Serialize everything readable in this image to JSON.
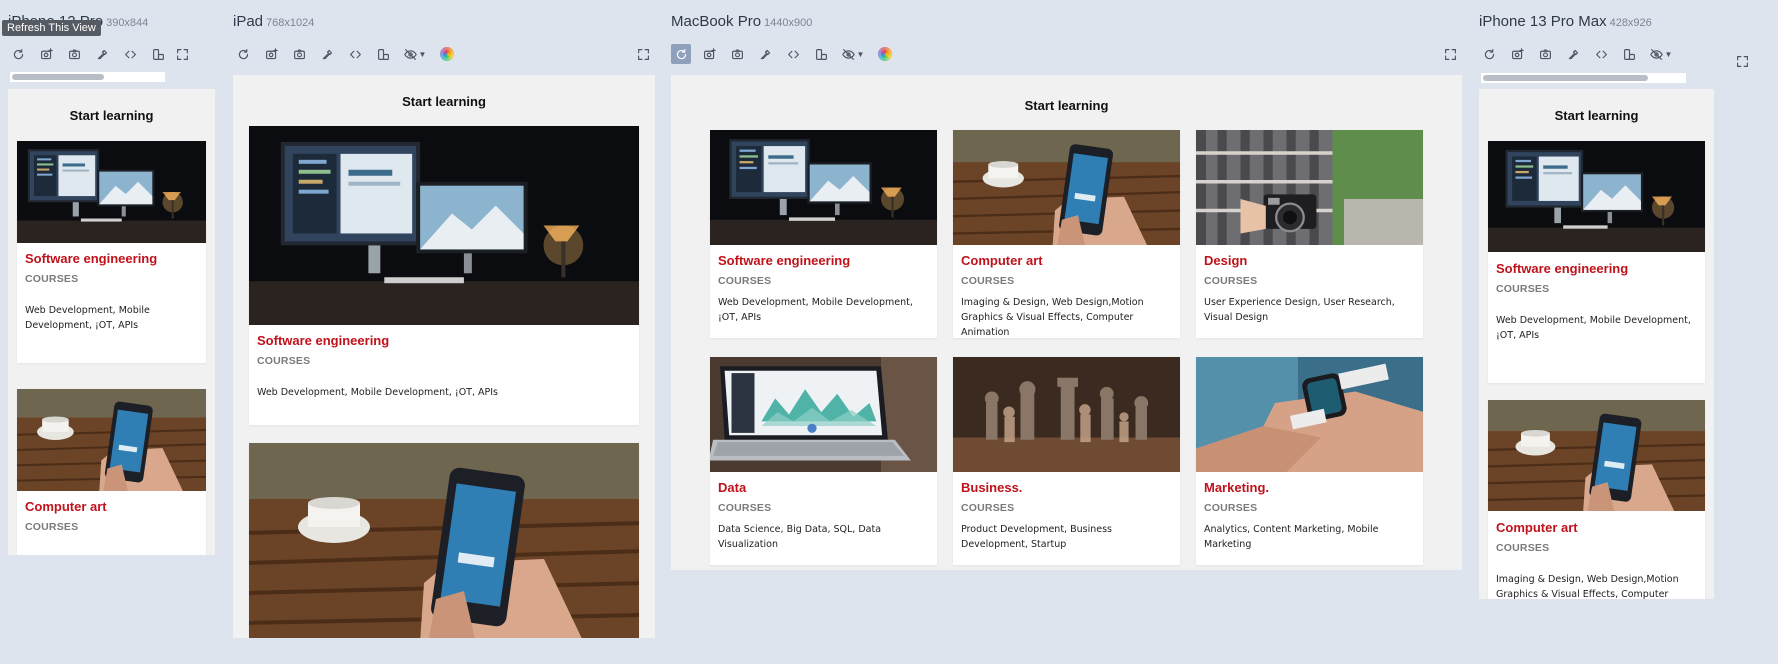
{
  "tooltip": "Refresh This View",
  "page_heading": "Start learning",
  "kicker": "COURSES",
  "devices": {
    "iphone12": {
      "name": "iPhone 12 Pro",
      "size": "390x844"
    },
    "ipad": {
      "name": "iPad",
      "size": "768x1024"
    },
    "macbook": {
      "name": "MacBook Pro",
      "size": "1440x900"
    },
    "iphone13": {
      "name": "iPhone 13 Pro Max",
      "size": "428x926"
    }
  },
  "courses": [
    {
      "title": "Software engineering",
      "desc": "Web Development, Mobile Development, ¡OT, APIs",
      "image": "desk-monitors-photo"
    },
    {
      "title": "Computer art",
      "desc": "Imaging & Design, Web Design,Motion Graphics & Visual Effects, Computer Animation",
      "image": "hand-phone-photo"
    },
    {
      "title": "Design",
      "desc": "User Experience Design, User Research, Visual Design",
      "image": "camera-photo"
    },
    {
      "title": "Data",
      "desc": "Data Science, Big Data, SQL, Data Visualization",
      "image": "laptop-dashboard-photo"
    },
    {
      "title": "Business.",
      "desc": "Product Development, Business Development, Startup",
      "image": "chess-photo"
    },
    {
      "title": "Marketing.",
      "desc": "Analytics, Content Marketing, Mobile Marketing",
      "image": "smartwatch-photo"
    }
  ],
  "colors": {
    "accent": "#c0121b",
    "kicker": "#7a7a7a",
    "canvas": "#dde4ee",
    "viewport": "#f1f1f1"
  }
}
